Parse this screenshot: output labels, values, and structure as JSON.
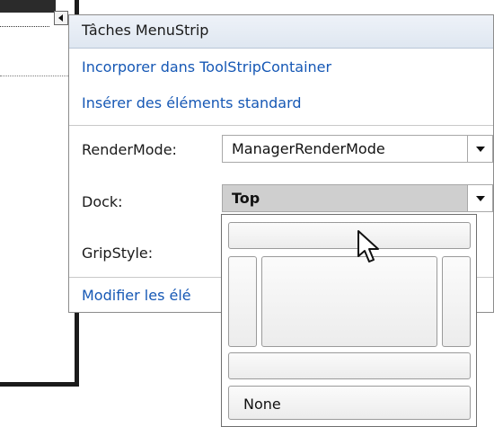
{
  "panel": {
    "title": "Tâches MenuStrip",
    "links": [
      "Incorporer dans ToolStripContainer",
      "Insérer des éléments standard"
    ],
    "edit_link": "Modifier les élé"
  },
  "properties": [
    {
      "label": "RenderMode:",
      "value": "ManagerRenderMode"
    },
    {
      "label": "Dock:",
      "value": "Top"
    },
    {
      "label": "GripStyle:",
      "value": ""
    }
  ],
  "dock_options": {
    "none_label": "None",
    "selected": "Top"
  }
}
